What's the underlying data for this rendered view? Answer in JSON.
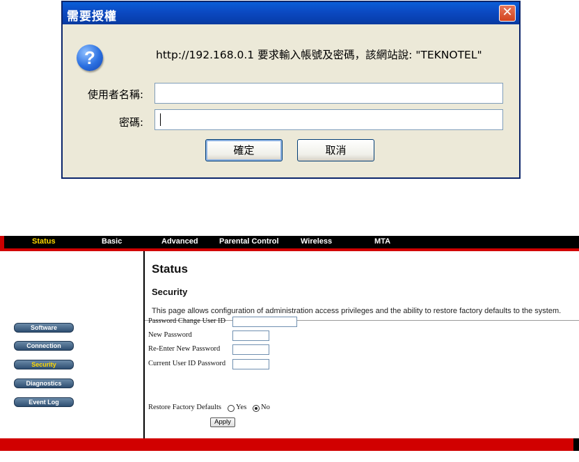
{
  "dialog": {
    "title": "需要授權",
    "close_symbol": "✕",
    "icon": "question-icon",
    "icon_glyph": "?",
    "message": "http://192.168.0.1 要求輸入帳號及密碼，該網站說: \"TEKNOTEL\"",
    "username_label": "使用者名稱:",
    "username_value": "",
    "password_label": "密碼:",
    "password_value": "",
    "ok_label": "確定",
    "cancel_label": "取消"
  },
  "router": {
    "nav": [
      "Status",
      "Basic",
      "Advanced",
      "Parental Control",
      "Wireless",
      "MTA"
    ],
    "nav_active": "Status",
    "sidebar": [
      "Software",
      "Connection",
      "Security",
      "Diagnostics",
      "Event Log"
    ],
    "sidebar_active": "Security",
    "page_title": "Status",
    "section_title": "Security",
    "description": "This page allows configuration of administration access privileges and the ability to restore factory defaults to the system.",
    "form": {
      "user_id_label": "Password Change User ID",
      "user_id_value": "",
      "new_password_label": "New Password",
      "reenter_label": "Re-Enter New Password",
      "current_password_label": "Current User ID Password",
      "restore_label": "Restore Factory Defaults",
      "yes_label": "Yes",
      "no_label": "No",
      "restore_selected": "No",
      "apply_label": "Apply"
    },
    "colors": {
      "accent_red": "#d10000",
      "bar_black": "#000000",
      "active_yellow": "#ffd800"
    }
  }
}
